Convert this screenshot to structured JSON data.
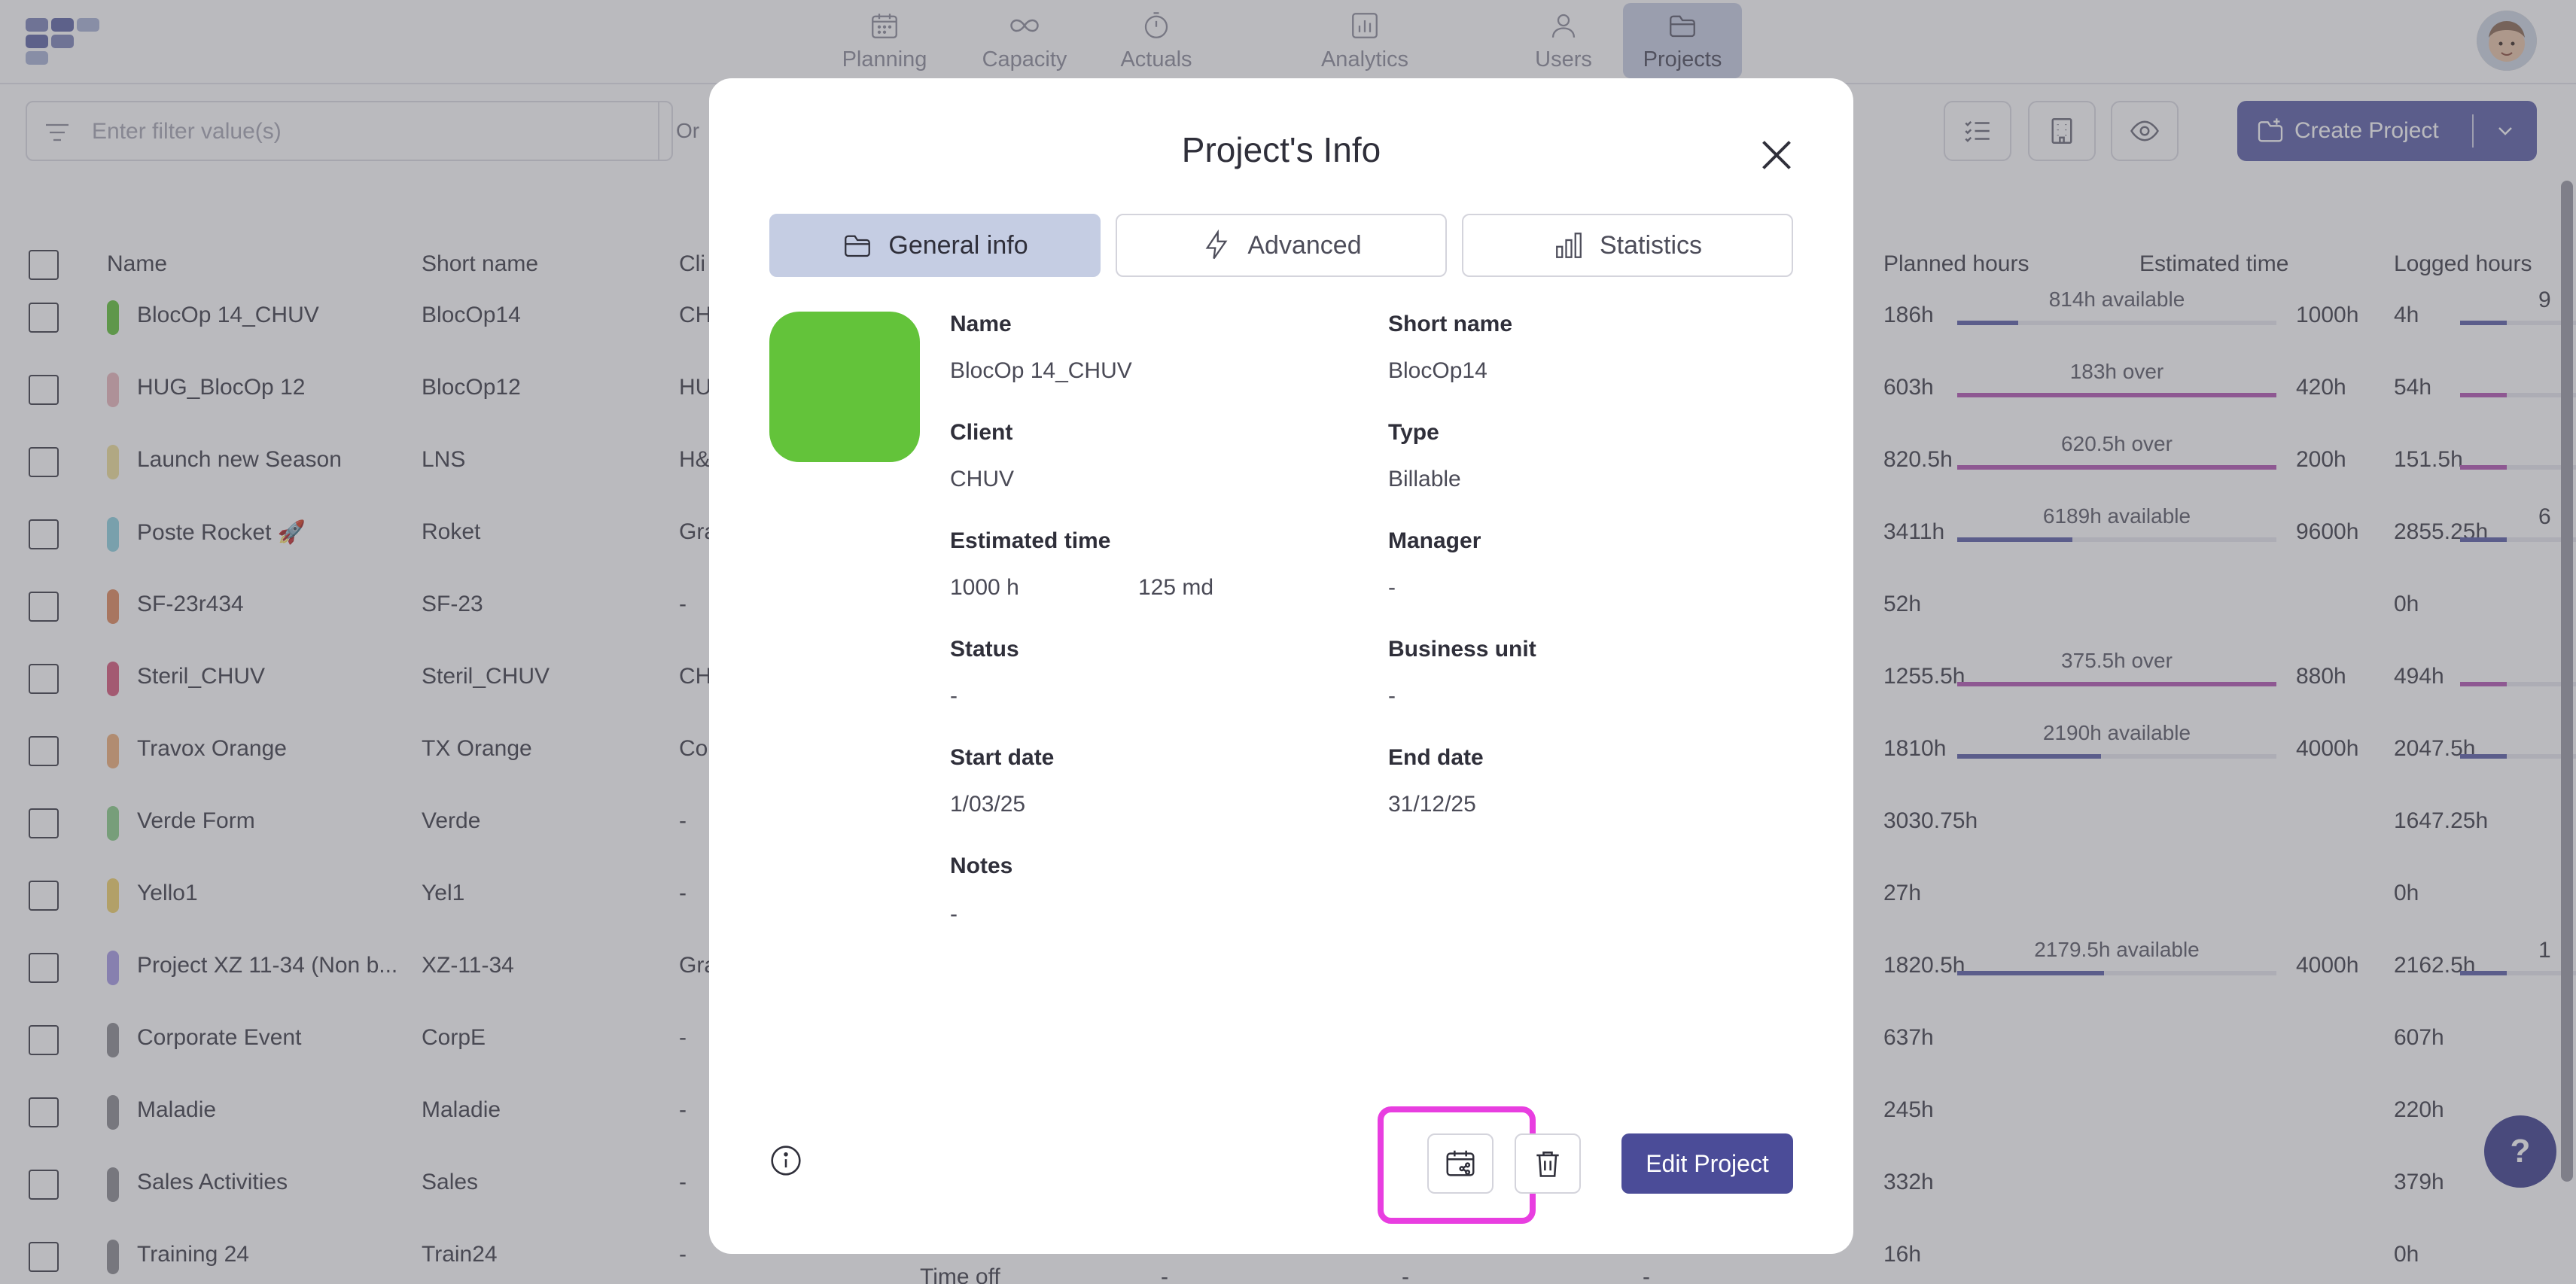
{
  "nav": {
    "items": [
      {
        "label": "Planning",
        "icon": "calendar-icon"
      },
      {
        "label": "Capacity",
        "icon": "infinity-icon"
      },
      {
        "label": "Actuals",
        "icon": "stopwatch-icon"
      },
      {
        "label": "Analytics",
        "icon": "bar-chart-icon"
      },
      {
        "label": "Users",
        "icon": "user-icon"
      },
      {
        "label": "Projects",
        "icon": "folder-icon",
        "active": true
      }
    ]
  },
  "toolbar": {
    "filter_placeholder": "Enter filter value(s)",
    "filter_operator": "Or",
    "create_label": "Create Project"
  },
  "table": {
    "headers": {
      "name": "Name",
      "short_name": "Short name",
      "client_partial": "Cli",
      "planned_hours": "Planned hours",
      "estimated_time": "Estimated time",
      "logged_hours": "Logged hours"
    },
    "rows": [
      {
        "name": "BlocOp 14_CHUV",
        "short": "BlocOp14",
        "client": "CH",
        "color": "#63c33a",
        "planned": "186h",
        "bar_label": "814h available",
        "progress": 0.19,
        "bar_color": "#5c5fa8",
        "estimated": "1000h",
        "logged": "4h",
        "extra": "9"
      },
      {
        "name": "HUG_BlocOp 12",
        "short": "BlocOp12",
        "client": "HU",
        "color": "#eab8bd",
        "planned": "603h",
        "bar_label": "183h over",
        "progress": 1.0,
        "bar_color": "#b457b4",
        "estimated": "420h",
        "logged": "54h",
        "extra": ""
      },
      {
        "name": "Launch new Season",
        "short": "LNS",
        "client": "H&",
        "color": "#efe09a",
        "planned": "820.5h",
        "bar_label": "620.5h over",
        "progress": 1.0,
        "bar_color": "#b457b4",
        "estimated": "200h",
        "logged": "151.5h",
        "extra": ""
      },
      {
        "name": "Poste Rocket 🚀",
        "short": "Roket",
        "client": "Gra",
        "color": "#8fd2e0",
        "planned": "3411h",
        "bar_label": "6189h available",
        "progress": 0.36,
        "bar_color": "#5c5fa8",
        "estimated": "9600h",
        "logged": "2855.25h",
        "extra": "6"
      },
      {
        "name": "SF-23r434",
        "short": "SF-23",
        "client": "-",
        "color": "#e08a5e",
        "planned": "52h",
        "bar_label": "",
        "progress": 0,
        "bar_color": "",
        "estimated": "",
        "logged": "0h",
        "extra": ""
      },
      {
        "name": "Steril_CHUV",
        "short": "Steril_CHUV",
        "client": "CH",
        "color": "#d85a7d",
        "planned": "1255.5h",
        "bar_label": "375.5h over",
        "progress": 1.0,
        "bar_color": "#b457b4",
        "estimated": "880h",
        "logged": "494h",
        "extra": ""
      },
      {
        "name": "Travox Orange",
        "short": "TX Orange",
        "client": "Co",
        "color": "#f0b07a",
        "planned": "1810h",
        "bar_label": "2190h available",
        "progress": 0.45,
        "bar_color": "#5c5fa8",
        "estimated": "4000h",
        "logged": "2047.5h",
        "extra": ""
      },
      {
        "name": "Verde Form",
        "short": "Verde",
        "client": "-",
        "color": "#8ccf8a",
        "planned": "3030.75h",
        "bar_label": "",
        "progress": 0,
        "bar_color": "",
        "estimated": "",
        "logged": "1647.25h",
        "extra": ""
      },
      {
        "name": "Yello1",
        "short": "Yel1",
        "client": "-",
        "color": "#f2d36b",
        "planned": "27h",
        "bar_label": "",
        "progress": 0,
        "bar_color": "",
        "estimated": "",
        "logged": "0h",
        "extra": ""
      },
      {
        "name": "Project XZ 11-34 (Non b...",
        "short": "XZ-11-34",
        "client": "Gra",
        "color": "#a89be6",
        "planned": "1820.5h",
        "bar_label": "2179.5h available",
        "progress": 0.46,
        "bar_color": "#5c5fa8",
        "estimated": "4000h",
        "logged": "2162.5h",
        "extra": "1"
      },
      {
        "name": "Corporate Event",
        "short": "CorpE",
        "client": "-",
        "color": "#8c8c92",
        "planned": "637h",
        "bar_label": "",
        "progress": 0,
        "bar_color": "",
        "estimated": "",
        "logged": "607h",
        "extra": ""
      },
      {
        "name": "Maladie",
        "short": "Maladie",
        "client": "-",
        "color": "#8c8c92",
        "planned": "245h",
        "bar_label": "",
        "progress": 0,
        "bar_color": "",
        "estimated": "",
        "logged": "220h",
        "extra": ""
      },
      {
        "name": "Sales Activities",
        "short": "Sales",
        "client": "-",
        "color": "#8c8c92",
        "planned": "332h",
        "bar_label": "",
        "progress": 0,
        "bar_color": "",
        "estimated": "",
        "logged": "379h",
        "extra": ""
      },
      {
        "name": "Training 24",
        "short": "Train24",
        "client": "-",
        "color": "#8c8c92",
        "planned": "16h",
        "bar_label": "",
        "progress": 0,
        "bar_color": "",
        "estimated": "",
        "logged": "0h",
        "extra": "",
        "type": "Time off",
        "c1": "-",
        "c2": "-",
        "c3": "-"
      }
    ]
  },
  "modal": {
    "title": "Project's Info",
    "tabs": {
      "general": "General info",
      "advanced": "Advanced",
      "statistics": "Statistics"
    },
    "project_color": "#63c33a",
    "fields": {
      "name_label": "Name",
      "name_value": "BlocOp 14_CHUV",
      "short_label": "Short name",
      "short_value": "BlocOp14",
      "client_label": "Client",
      "client_value": "CHUV",
      "type_label": "Type",
      "type_value": "Billable",
      "est_label": "Estimated time",
      "est_hours": "1000 h",
      "est_md": "125 md",
      "manager_label": "Manager",
      "manager_value": "-",
      "status_label": "Status",
      "status_value": "-",
      "bu_label": "Business unit",
      "bu_value": "-",
      "start_label": "Start date",
      "start_value": "1/03/25",
      "end_label": "End date",
      "end_value": "31/12/25",
      "notes_label": "Notes",
      "notes_value": "-"
    },
    "edit_label": "Edit Project"
  },
  "help": {
    "label": "?"
  }
}
